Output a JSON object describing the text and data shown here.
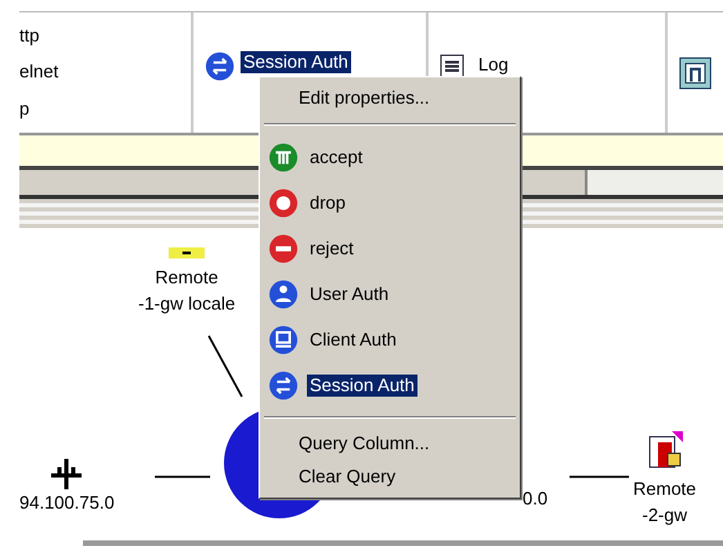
{
  "rule_row": {
    "services": [
      "ttp",
      "elnet",
      "p"
    ],
    "action": {
      "label": "Session Auth",
      "selected": true
    },
    "track": {
      "label": "Log"
    }
  },
  "diagram": {
    "nodes": [
      {
        "kind": "host",
        "label": [
          "Remote",
          "-1-gw locale"
        ]
      },
      {
        "kind": "network",
        "label": [
          "94.100.75.0"
        ]
      },
      {
        "kind": "gateway"
      },
      {
        "kind": "network",
        "label": [
          "0.0"
        ]
      },
      {
        "kind": "host",
        "label": [
          "Remote",
          "-2-gw"
        ]
      }
    ]
  },
  "context_menu": {
    "items": [
      {
        "kind": "command",
        "label": "Edit properties..."
      },
      {
        "kind": "separator"
      },
      {
        "kind": "action",
        "label": "accept",
        "selected": false
      },
      {
        "kind": "action",
        "label": "drop",
        "selected": false
      },
      {
        "kind": "action",
        "label": "reject",
        "selected": false
      },
      {
        "kind": "action",
        "label": "User Auth",
        "selected": false
      },
      {
        "kind": "action",
        "label": "Client Auth",
        "selected": false
      },
      {
        "kind": "action",
        "label": "Session Auth",
        "selected": true
      },
      {
        "kind": "separator"
      },
      {
        "kind": "command",
        "label": "Query Column..."
      },
      {
        "kind": "command",
        "label": "Clear Query"
      }
    ]
  }
}
